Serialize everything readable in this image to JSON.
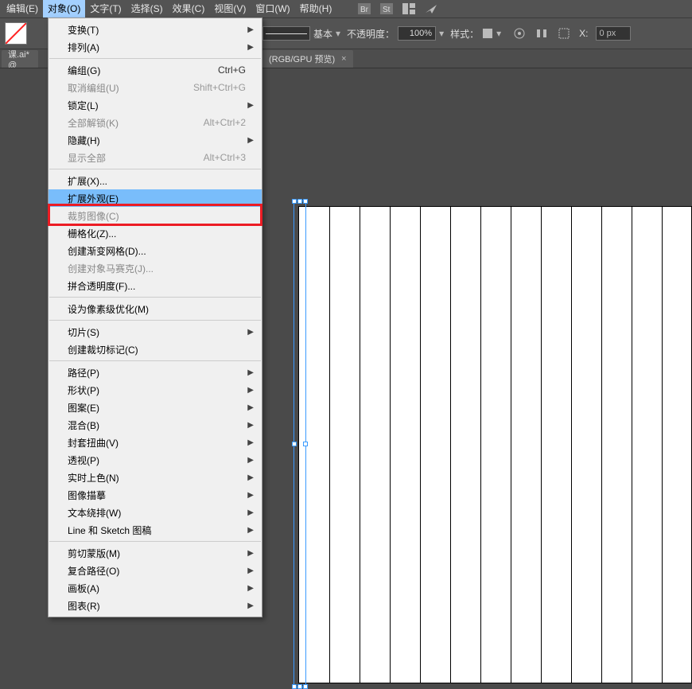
{
  "menubar": {
    "items": [
      "编辑(E)",
      "对象(O)",
      "文字(T)",
      "选择(S)",
      "效果(C)",
      "视图(V)",
      "窗口(W)",
      "帮助(H)"
    ],
    "active_index": 1
  },
  "toolbar": {
    "stroke_style_label": "基本",
    "opacity_label": "不透明度：",
    "opacity_value": "100%",
    "style_label": "样式：",
    "x_label": "X:",
    "x_value": "0 px"
  },
  "tabbar": {
    "tab_left_fragment": "课.ai* @",
    "tab_main_fragment": "(RGB/GPU 预览)",
    "tab_close": "×"
  },
  "dropdown": {
    "groups": [
      [
        {
          "label": "变换(T)",
          "sub": true
        },
        {
          "label": "排列(A)",
          "sub": true
        }
      ],
      [
        {
          "label": "编组(G)",
          "shortcut": "Ctrl+G"
        },
        {
          "label": "取消编组(U)",
          "shortcut": "Shift+Ctrl+G",
          "disabled": true
        },
        {
          "label": "锁定(L)",
          "sub": true
        },
        {
          "label": "全部解锁(K)",
          "shortcut": "Alt+Ctrl+2",
          "disabled": true
        },
        {
          "label": "隐藏(H)",
          "sub": true
        },
        {
          "label": "显示全部",
          "shortcut": "Alt+Ctrl+3",
          "disabled": true
        }
      ],
      [
        {
          "label": "扩展(X)..."
        },
        {
          "label": "扩展外观(E)",
          "highlight": true
        },
        {
          "label": "裁剪图像(C)",
          "disabled": true
        },
        {
          "label": "栅格化(Z)..."
        },
        {
          "label": "创建渐变网格(D)..."
        },
        {
          "label": "创建对象马赛克(J)...",
          "disabled": true
        },
        {
          "label": "拼合透明度(F)..."
        }
      ],
      [
        {
          "label": "设为像素级优化(M)"
        }
      ],
      [
        {
          "label": "切片(S)",
          "sub": true
        },
        {
          "label": "创建裁切标记(C)"
        }
      ],
      [
        {
          "label": "路径(P)",
          "sub": true
        },
        {
          "label": "形状(P)",
          "sub": true
        },
        {
          "label": "图案(E)",
          "sub": true
        },
        {
          "label": "混合(B)",
          "sub": true
        },
        {
          "label": "封套扭曲(V)",
          "sub": true
        },
        {
          "label": "透视(P)",
          "sub": true
        },
        {
          "label": "实时上色(N)",
          "sub": true
        },
        {
          "label": "图像描摹",
          "sub": true
        },
        {
          "label": "文本绕排(W)",
          "sub": true
        },
        {
          "label": "Line 和 Sketch 图稿",
          "sub": true
        }
      ],
      [
        {
          "label": "剪切蒙版(M)",
          "sub": true
        },
        {
          "label": "复合路径(O)",
          "sub": true
        },
        {
          "label": "画板(A)",
          "sub": true
        },
        {
          "label": "图表(R)",
          "sub": true
        }
      ]
    ]
  }
}
